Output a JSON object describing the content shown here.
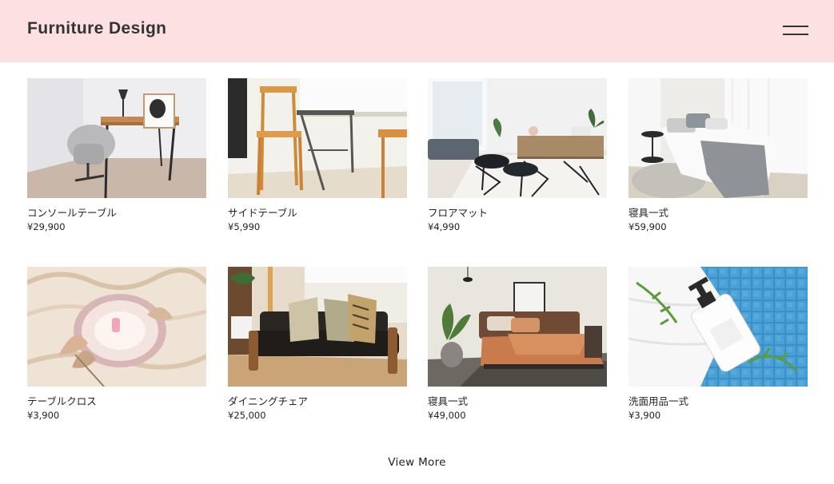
{
  "header": {
    "brand": "Furniture Design",
    "menu_icon": "hamburger-menu-icon"
  },
  "products": [
    {
      "name": "コンソールテーブル",
      "price": "¥29,900",
      "image": "console-table-photo"
    },
    {
      "name": "サイドテーブル",
      "price": "¥5,990",
      "image": "side-table-photo"
    },
    {
      "name": "フロアマット",
      "price": "¥4,990",
      "image": "floor-mat-photo"
    },
    {
      "name": "寝具一式",
      "price": "¥59,900",
      "image": "bedding-set-photo"
    },
    {
      "name": "テーブルクロス",
      "price": "¥3,900",
      "image": "tablecloth-photo"
    },
    {
      "name": "ダイニングチェア",
      "price": "¥25,000",
      "image": "dining-chair-photo"
    },
    {
      "name": "寝具一式",
      "price": "¥49,000",
      "image": "bedding-set-photo"
    },
    {
      "name": "洗面用品一式",
      "price": "¥3,900",
      "image": "toiletries-set-photo"
    }
  ],
  "footer": {
    "view_more": "View More"
  },
  "colors": {
    "header_bg": "#fde0e2",
    "text": "#222222"
  }
}
